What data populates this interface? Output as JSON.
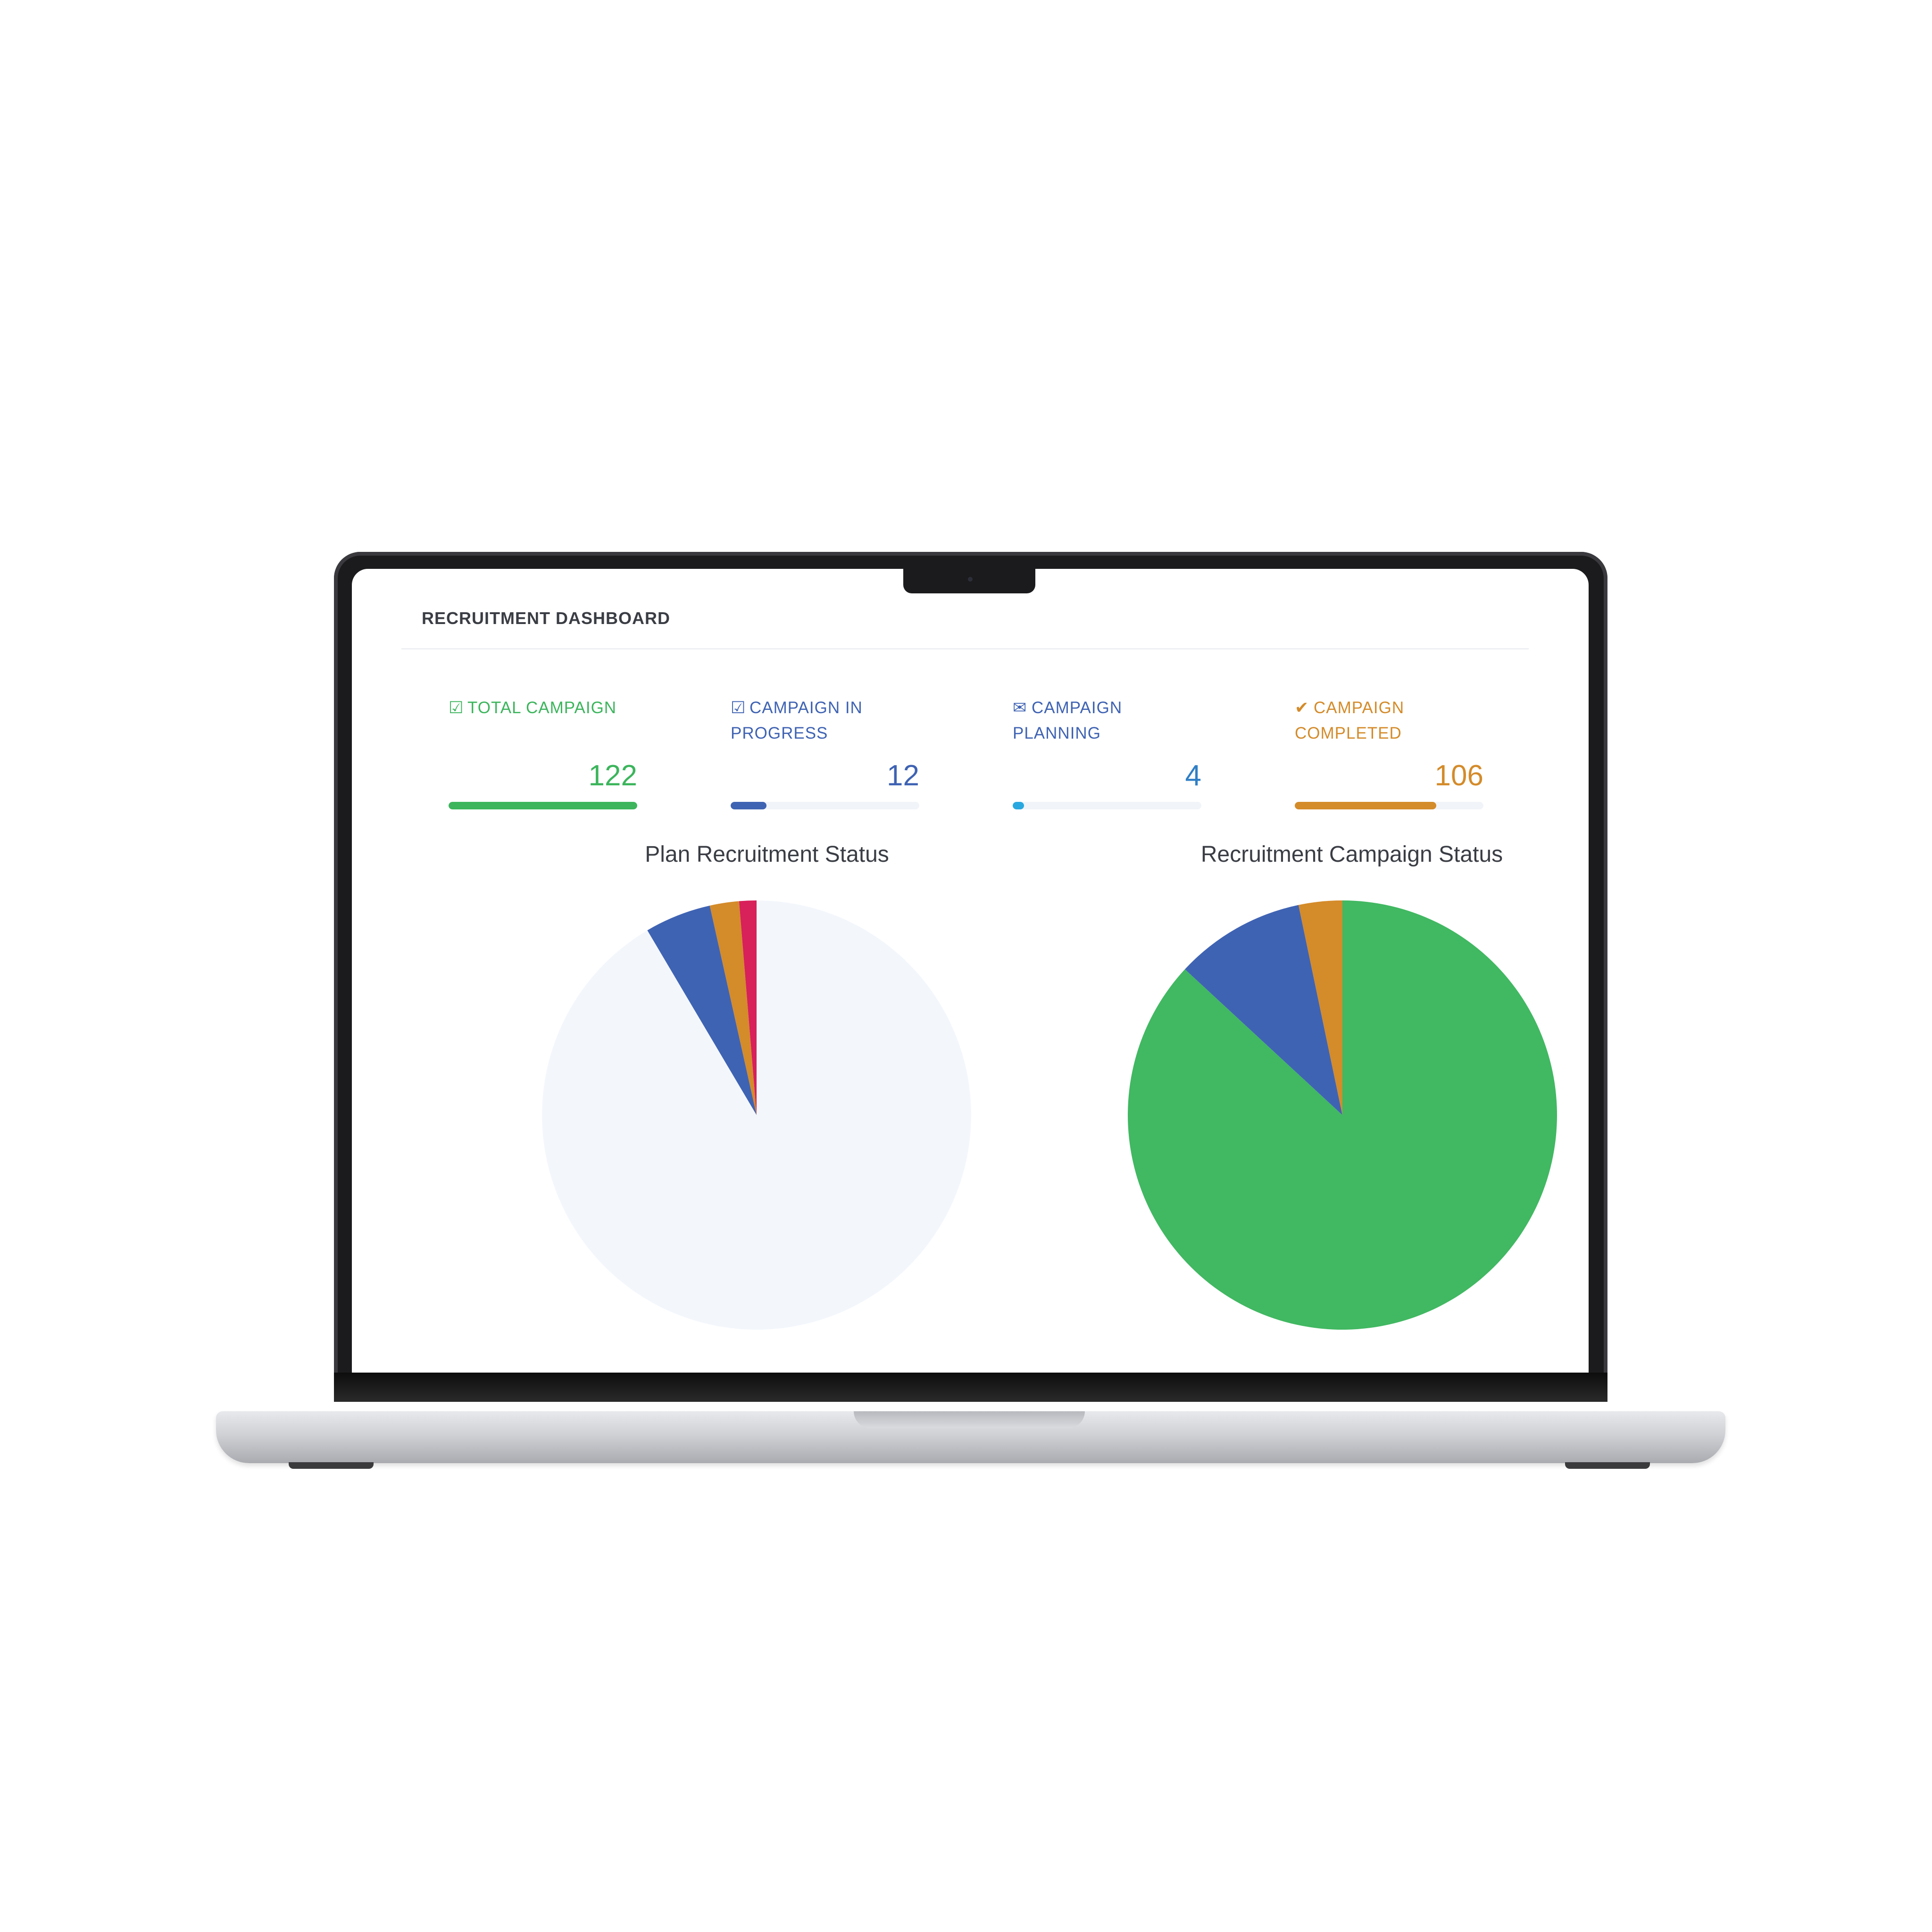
{
  "header": {
    "title": "RECRUITMENT DASHBOARD"
  },
  "stats": [
    {
      "icon": "edit-square-icon",
      "glyph": "☑",
      "label": "TOTAL CAMPAIGN",
      "value": "122",
      "progress": 1.0,
      "color": "#3cb55c"
    },
    {
      "icon": "edit-square-icon",
      "glyph": "☑",
      "label": "CAMPAIGN IN PROGRESS",
      "value": "12",
      "progress": 0.19,
      "color": "#3f63b3"
    },
    {
      "icon": "envelope-icon",
      "glyph": "✉",
      "label": "CAMPAIGN PLANNING",
      "value": "4",
      "progress": 0.06,
      "color": "#29a8e0"
    },
    {
      "icon": "check-icon",
      "glyph": "✔",
      "label": "CAMPAIGN COMPLETED",
      "value": "106",
      "progress": 0.75,
      "color": "#d48b2a"
    }
  ],
  "chart_data": [
    {
      "type": "pie",
      "title": "Plan Recruitment Status",
      "slices": [
        {
          "value": 91.5,
          "color": "#f3f7fc"
        },
        {
          "value": 5.0,
          "color": "#3f63b3"
        },
        {
          "value": 2.2,
          "color": "#d48b2a"
        },
        {
          "value": 1.3,
          "color": "#d8205a"
        }
      ]
    },
    {
      "type": "pie",
      "title": "Recruitment Campaign Status",
      "slices": [
        {
          "value": 106,
          "color": "#41b862"
        },
        {
          "value": 12,
          "color": "#3f63b3"
        },
        {
          "value": 4,
          "color": "#d48b2a"
        }
      ]
    }
  ]
}
